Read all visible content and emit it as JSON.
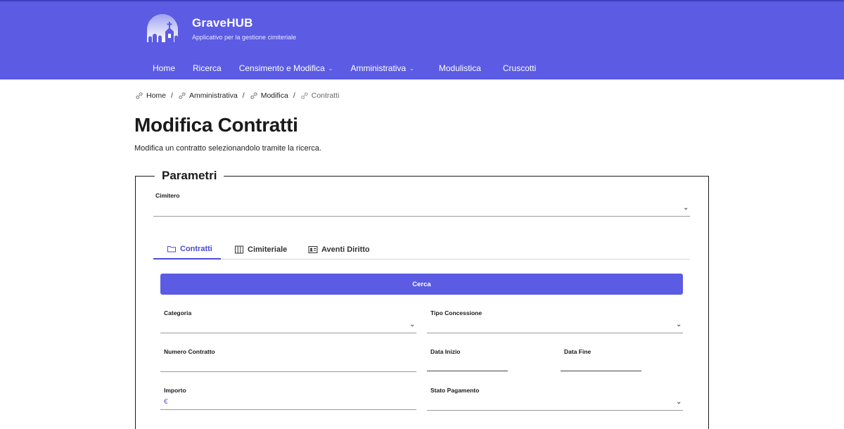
{
  "brand": {
    "title": "GraveHUB",
    "subtitle": "Applicativo per la gestione cimiteriale"
  },
  "nav": [
    {
      "label": "Home",
      "dropdown": false
    },
    {
      "label": "Ricerca",
      "dropdown": false
    },
    {
      "label": "Censimento e Modifica",
      "dropdown": true
    },
    {
      "label": "Amministrativa",
      "dropdown": true
    },
    {
      "label": "Modulistica",
      "dropdown": false
    },
    {
      "label": "Cruscotti",
      "dropdown": false
    }
  ],
  "breadcrumb": [
    {
      "label": "Home"
    },
    {
      "label": "Amministrativa"
    },
    {
      "label": "Modifica"
    },
    {
      "label": "Contratti"
    }
  ],
  "breadcrumb_separator": "/",
  "page": {
    "title": "Modifica Contratti",
    "description": "Modifica un contratto selezionandolo tramite la ricerca."
  },
  "form": {
    "legend": "Parametri",
    "cimitero_label": "Cimitero",
    "tabs": [
      {
        "label": "Contratti",
        "icon": "folder-icon",
        "active": true
      },
      {
        "label": "Cimiteriale",
        "icon": "columns-icon",
        "active": false
      },
      {
        "label": "Aventi Diritto",
        "icon": "id-card-icon",
        "active": false
      }
    ],
    "search_button": "Cerca",
    "fields": {
      "categoria": "Categoria",
      "tipo_concessione": "Tipo Concessione",
      "numero_contratto": "Numero Contratto",
      "data_inizio": "Data Inizio",
      "data_fine": "Data Fine",
      "importo": "Importo",
      "importo_prefix": "€",
      "stato_pagamento": "Stato Pagamento"
    }
  },
  "colors": {
    "primary": "#5b5be3",
    "tab_active": "#4b4bd6"
  }
}
